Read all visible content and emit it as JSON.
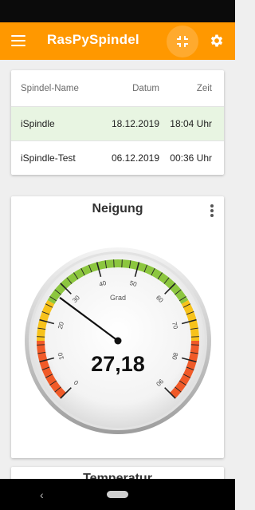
{
  "app": {
    "title": "RasPySpindel",
    "icons": {
      "menu": "menu-icon",
      "collapse": "fullscreen-exit-icon",
      "settings": "gear-icon"
    },
    "accent_color": "#ff9800"
  },
  "table": {
    "headers": [
      "Spindel-Name",
      "Datum",
      "Zeit"
    ],
    "rows": [
      {
        "name": "iSpindle",
        "date": "18.12.2019",
        "time": "18:04 Uhr",
        "selected": true
      },
      {
        "name": "iSpindle-Test",
        "date": "06.12.2019",
        "time": "00:36 Uhr",
        "selected": false
      }
    ],
    "selected_row_color": "#e8f5e2"
  },
  "gauge_card": {
    "title": "Neigung",
    "unit_label": "Grad",
    "value_text": "27,18",
    "value": 27.18,
    "min": 0,
    "max": 90,
    "tick_labels": [
      "0",
      "10",
      "20",
      "30",
      "40",
      "50",
      "60",
      "70",
      "80",
      "90"
    ],
    "zones": [
      {
        "from": 0,
        "to": 15,
        "color": "#f05a28"
      },
      {
        "from": 15,
        "to": 25,
        "color": "#f7c21b"
      },
      {
        "from": 25,
        "to": 65,
        "color": "#8cc63f"
      },
      {
        "from": 65,
        "to": 75,
        "color": "#f7c21b"
      },
      {
        "from": 75,
        "to": 90,
        "color": "#f05a28"
      }
    ]
  },
  "next_card": {
    "title": "Temperatur"
  }
}
